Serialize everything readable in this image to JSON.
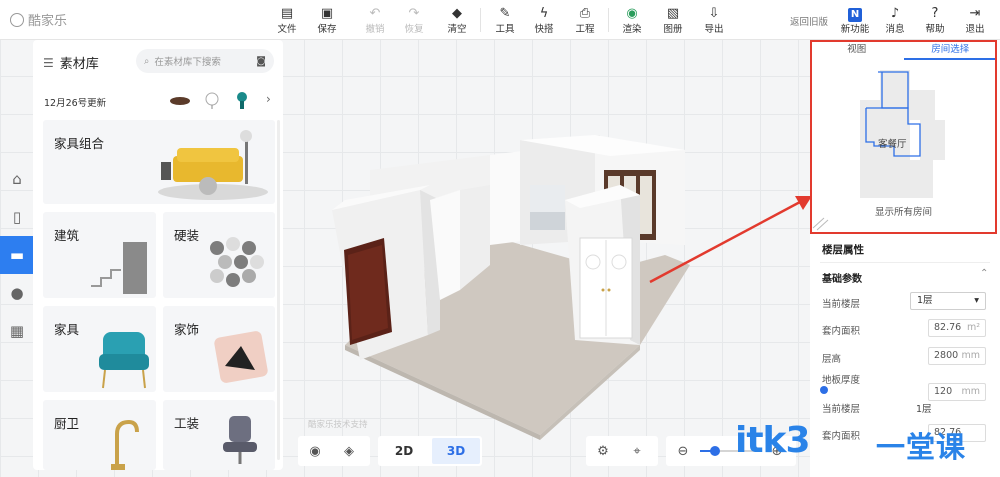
{
  "app": {
    "logo_text": "酷家乐"
  },
  "toolbar": {
    "items": [
      {
        "label": "文件",
        "icon": "file-icon"
      },
      {
        "label": "保存",
        "icon": "save-icon"
      },
      {
        "label": "撤销",
        "icon": "undo-icon"
      },
      {
        "label": "恢复",
        "icon": "redo-icon"
      },
      {
        "label": "清空",
        "icon": "eraser-icon"
      },
      {
        "label": "工具",
        "icon": "wrench-icon"
      },
      {
        "label": "快搭",
        "icon": "lightning-icon"
      },
      {
        "label": "工程",
        "icon": "project-icon"
      },
      {
        "label": "渲染",
        "icon": "render-icon"
      },
      {
        "label": "图册",
        "icon": "album-icon"
      },
      {
        "label": "导出",
        "icon": "export-icon"
      }
    ],
    "return_old": "返回旧版",
    "right_items": [
      {
        "label": "新功能",
        "icon": "new-feature-icon"
      },
      {
        "label": "消息",
        "icon": "bell-icon"
      },
      {
        "label": "帮助",
        "icon": "help-icon"
      },
      {
        "label": "退出",
        "icon": "logout-icon"
      }
    ]
  },
  "library": {
    "title": "素材库",
    "search_placeholder": "在素材库下搜索",
    "update_text": "12月26号更新",
    "cards": [
      {
        "title": "家具组合"
      },
      {
        "title": "建筑"
      },
      {
        "title": "硬装"
      },
      {
        "title": "家具"
      },
      {
        "title": "家饰"
      },
      {
        "title": "厨卫"
      },
      {
        "title": "工装"
      }
    ]
  },
  "viewport": {
    "watermark": "酷家乐技术支持",
    "view_2d": "2D",
    "view_3d": "3D"
  },
  "right_panel": {
    "tabs": [
      "视图",
      "房间选择"
    ],
    "room_label": "客餐厅",
    "show_all": "显示所有房间",
    "floor_props_title": "楼层属性",
    "basic_params_title": "基础参数",
    "current_floor_label": "当前楼层",
    "current_floor_value": "1层",
    "indoor_area_label": "套内面积",
    "indoor_area_value": "82.76",
    "indoor_area_unit": "m²",
    "floor_height_label": "层高",
    "floor_height_value": "2800",
    "floor_height_unit": "mm",
    "slab_thickness_label": "地板厚度",
    "slab_thickness_value": "120",
    "slab_thickness_unit": "mm",
    "ghost_floor_label": "当前楼层",
    "ghost_floor_value": "1层",
    "ghost_area_label": "套内面积",
    "ghost_area_value": "82.76"
  },
  "brand": {
    "name": "itk3",
    "cn": "一堂课"
  },
  "colors": {
    "accent": "#2d6fe6",
    "annotation": "#e23a2e",
    "brand": "#2a83e8"
  }
}
